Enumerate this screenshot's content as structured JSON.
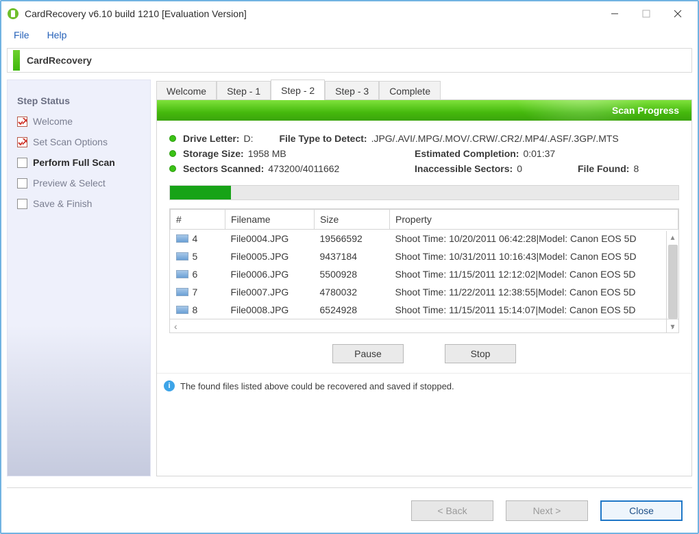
{
  "title": "CardRecovery v6.10 build 1210 [Evaluation Version]",
  "menu": {
    "file": "File",
    "help": "Help"
  },
  "banner": {
    "title": "CardRecovery"
  },
  "sidebar": {
    "heading": "Step Status",
    "items": [
      {
        "label": "Welcome"
      },
      {
        "label": "Set Scan Options"
      },
      {
        "label": "Perform Full Scan"
      },
      {
        "label": "Preview & Select"
      },
      {
        "label": "Save & Finish"
      }
    ]
  },
  "tabs": {
    "welcome": "Welcome",
    "step1": "Step - 1",
    "step2": "Step - 2",
    "step3": "Step - 3",
    "complete": "Complete"
  },
  "scan_header": "Scan Progress",
  "info": {
    "drive_letter_label": "Drive Letter:",
    "drive_letter_value": "D:",
    "file_type_label": "File Type to Detect:",
    "file_type_value": ".JPG/.AVI/.MPG/.MOV/.CRW/.CR2/.MP4/.ASF/.3GP/.MTS",
    "storage_label": "Storage Size:",
    "storage_value": "1958 MB",
    "eta_label": "Estimated Completion:",
    "eta_value": "0:01:37",
    "sectors_label": "Sectors Scanned:",
    "sectors_value": "473200/4011662",
    "inacc_label": "Inaccessible Sectors:",
    "inacc_value": "0",
    "found_label": "File Found:",
    "found_value": "8"
  },
  "table": {
    "headers": {
      "num": "#",
      "filename": "Filename",
      "size": "Size",
      "property": "Property"
    },
    "rows": [
      {
        "num": "4",
        "filename": "File0004.JPG",
        "size": "19566592",
        "property": "Shoot Time: 10/20/2011 06:42:28|Model: Canon EOS 5D"
      },
      {
        "num": "5",
        "filename": "File0005.JPG",
        "size": "9437184",
        "property": "Shoot Time: 10/31/2011 10:16:43|Model: Canon EOS 5D"
      },
      {
        "num": "6",
        "filename": "File0006.JPG",
        "size": "5500928",
        "property": "Shoot Time: 11/15/2011 12:12:02|Model: Canon EOS 5D"
      },
      {
        "num": "7",
        "filename": "File0007.JPG",
        "size": "4780032",
        "property": "Shoot Time: 11/22/2011 12:38:55|Model: Canon EOS 5D"
      },
      {
        "num": "8",
        "filename": "File0008.JPG",
        "size": "6524928",
        "property": "Shoot Time: 11/15/2011 15:14:07|Model: Canon EOS 5D"
      }
    ]
  },
  "buttons": {
    "pause": "Pause",
    "stop": "Stop",
    "back": "< Back",
    "next": "Next >",
    "close": "Close"
  },
  "hint": "The found files listed above could be recovered and saved if stopped."
}
